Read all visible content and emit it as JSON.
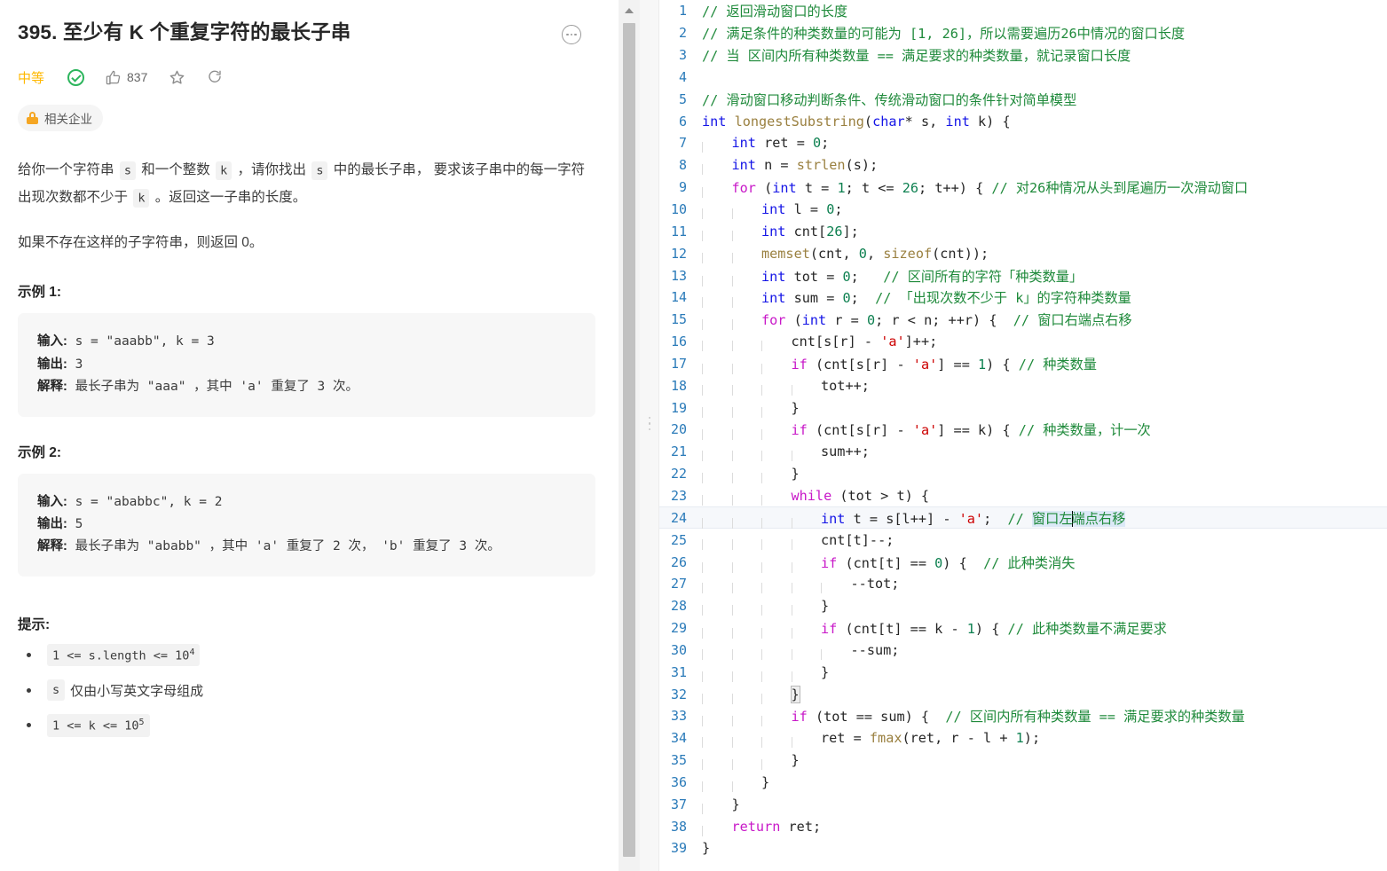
{
  "problem": {
    "title": "395. 至少有 K 个重复字符的最长子串",
    "difficulty": "中等",
    "likes": "837",
    "company_badge": "相关企业",
    "icons": {
      "more": "more-options-icon",
      "solved": "solved-check-icon",
      "like": "thumbs-up-icon",
      "favorite": "star-icon",
      "share": "share-icon",
      "lock": "lock-icon"
    },
    "description": [
      {
        "parts": [
          {
            "t": "给你一个字符串 ",
            "code": false
          },
          {
            "t": "s",
            "code": true
          },
          {
            "t": " 和一个整数 ",
            "code": false
          },
          {
            "t": "k",
            "code": true
          },
          {
            "t": " ，请你找出 ",
            "code": false
          },
          {
            "t": "s",
            "code": true
          },
          {
            "t": " 中的最长子串， 要求该子串中的每一字符出现次数都不少于 ",
            "code": false
          },
          {
            "t": "k",
            "code": true
          },
          {
            "t": " 。返回这一子串的长度。",
            "code": false
          }
        ]
      },
      {
        "parts": [
          {
            "t": "如果不存在这样的子字符串，则返回 0。",
            "code": false
          }
        ]
      }
    ],
    "examples": [
      {
        "heading": "示例 1:",
        "input_label": "输入:",
        "input_value": " s = \"aaabb\", k = 3",
        "output_label": "输出:",
        "output_value": " 3",
        "explain_label": "解释:",
        "explain_value": " 最长子串为 \"aaa\" ，其中 'a' 重复了 3 次。"
      },
      {
        "heading": "示例 2:",
        "input_label": "输入:",
        "input_value": " s = \"ababbc\", k = 2",
        "output_label": "输出:",
        "output_value": " 5",
        "explain_label": "解释:",
        "explain_value": " 最长子串为 \"ababb\" ，其中 'a' 重复了 2 次， 'b' 重复了 3 次。"
      }
    ],
    "hints_heading": "提示:",
    "hints": [
      {
        "base": "1 <= s.length <= 10",
        "sup": "4",
        "tail": ""
      },
      {
        "base": "s",
        "sup": "",
        "tail": " 仅由小写英文字母组成"
      },
      {
        "base": "1 <= k <= 10",
        "sup": "5",
        "tail": ""
      }
    ]
  },
  "editor": {
    "active_line": 24,
    "cursor_after": "窗口左",
    "selection_text": "窗口左端点右移",
    "colors": {
      "comment": "#1f8a3b",
      "keyword": "#c818c8",
      "type": "#1414e6",
      "number": "#0d8050",
      "function": "#9a8040",
      "string": "#cc0000",
      "linenumber": "#2b7bb9",
      "selection": "#dce9f7",
      "active_line_bg": "#f6f8fb"
    },
    "lines": [
      {
        "n": "1",
        "code": "// 返回滑动窗口的长度"
      },
      {
        "n": "2",
        "code": "// 满足条件的种类数量的可能为 [1, 26]，所以需要遍历26中情况的窗口长度"
      },
      {
        "n": "3",
        "code": "// 当 区间内所有种类数量 == 满足要求的种类数量，就记录窗口长度"
      },
      {
        "n": "4",
        "code": ""
      },
      {
        "n": "5",
        "code": "// 滑动窗口移动判断条件、传统滑动窗口的条件针对简单模型"
      },
      {
        "n": "6",
        "code": "int longestSubstring(char* s, int k) {"
      },
      {
        "n": "7",
        "code": "    int ret = 0;"
      },
      {
        "n": "8",
        "code": "    int n = strlen(s);"
      },
      {
        "n": "9",
        "code": "    for (int t = 1; t <= 26; t++) { // 对26种情况从头到尾遍历一次滑动窗口"
      },
      {
        "n": "10",
        "code": "        int l = 0;"
      },
      {
        "n": "11",
        "code": "        int cnt[26];"
      },
      {
        "n": "12",
        "code": "        memset(cnt, 0, sizeof(cnt));"
      },
      {
        "n": "13",
        "code": "        int tot = 0;   // 区间所有的字符「种类数量」"
      },
      {
        "n": "14",
        "code": "        int sum = 0;  // 「出现次数不少于 k」的字符种类数量"
      },
      {
        "n": "15",
        "code": "        for (int r = 0; r < n; ++r) {  // 窗口右端点右移"
      },
      {
        "n": "16",
        "code": "            cnt[s[r] - 'a']++;"
      },
      {
        "n": "17",
        "code": "            if (cnt[s[r] - 'a'] == 1) { // 种类数量"
      },
      {
        "n": "18",
        "code": "                tot++;"
      },
      {
        "n": "19",
        "code": "            }"
      },
      {
        "n": "20",
        "code": "            if (cnt[s[r] - 'a'] == k) { // 种类数量，计一次"
      },
      {
        "n": "21",
        "code": "                sum++;"
      },
      {
        "n": "22",
        "code": "            }"
      },
      {
        "n": "23",
        "code": "            while (tot > t) {"
      },
      {
        "n": "24",
        "code": "                int t = s[l++] - 'a';  // 窗口左端点右移"
      },
      {
        "n": "25",
        "code": "                cnt[t]--;"
      },
      {
        "n": "26",
        "code": "                if (cnt[t] == 0) {  // 此种类消失"
      },
      {
        "n": "27",
        "code": "                    --tot;"
      },
      {
        "n": "28",
        "code": "                }"
      },
      {
        "n": "29",
        "code": "                if (cnt[t] == k - 1) { // 此种类数量不满足要求"
      },
      {
        "n": "30",
        "code": "                    --sum;"
      },
      {
        "n": "31",
        "code": "                }"
      },
      {
        "n": "32",
        "code": "            }"
      },
      {
        "n": "33",
        "code": "            if (tot == sum) {  // 区间内所有种类数量 == 满足要求的种类数量"
      },
      {
        "n": "34",
        "code": "                ret = fmax(ret, r - l + 1);"
      },
      {
        "n": "35",
        "code": "            }"
      },
      {
        "n": "36",
        "code": "        }"
      },
      {
        "n": "37",
        "code": "    }"
      },
      {
        "n": "38",
        "code": "    return ret;"
      },
      {
        "n": "39",
        "code": "}"
      }
    ]
  }
}
